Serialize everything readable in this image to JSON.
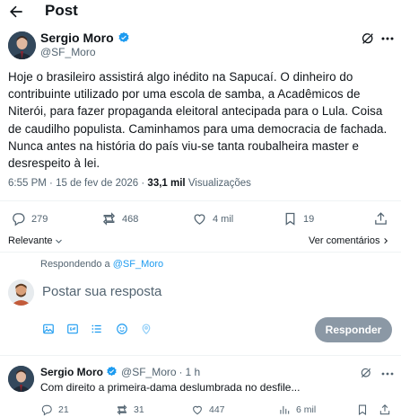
{
  "header": {
    "title": "Post"
  },
  "post": {
    "author_name": "Sergio Moro",
    "author_handle": "@SF_Moro",
    "text": "Hoje o brasileiro assistirá algo inédito na Sapucaí. O dinheiro do contribuinte utilizado por uma escola de samba, a Acadêmicos de Niterói, para fazer propaganda eleitoral antecipada para o Lula. Coisa de caudilho populista. Caminhamos para uma democracia de fachada. Nunca antes na história do país viu-se tanta roubalheira master e desrespeito à lei.",
    "time": "6:55 PM",
    "date": "15 de fev de 2026",
    "separator": "·",
    "views_count": "33,1 mil",
    "views_label": "Visualizações",
    "replies": "279",
    "reposts": "468",
    "likes": "4 mil",
    "bookmarks": "19"
  },
  "sort": {
    "label": "Relevante"
  },
  "view_replies": {
    "label": "Ver comentários"
  },
  "composer": {
    "replying_prefix": "Respondendo a",
    "replying_handle": "@SF_Moro",
    "placeholder": "Postar sua resposta",
    "reply_button": "Responder"
  },
  "reply": {
    "author_name": "Sergio Moro",
    "author_handle": "@SF_Moro",
    "separator": "·",
    "time": "1 h",
    "text": "Com direito a primeira-dama deslumbrada no desfile...",
    "replies": "21",
    "reposts": "31",
    "likes": "447",
    "views": "6 mil"
  },
  "colors": {
    "accent": "#1d9bf0",
    "muted": "#536471",
    "text": "#0f1419",
    "divider": "#eff3f4",
    "button_disabled": "#8b98a5"
  },
  "icons": [
    "back-arrow-icon",
    "verified-badge-icon",
    "grok-icon",
    "more-icon",
    "reply-icon",
    "repost-icon",
    "like-icon",
    "bookmark-icon",
    "share-icon",
    "chevron-down-icon",
    "chevron-right-icon",
    "image-icon",
    "gif-icon",
    "list-icon",
    "emoji-icon",
    "location-icon",
    "views-icon"
  ]
}
